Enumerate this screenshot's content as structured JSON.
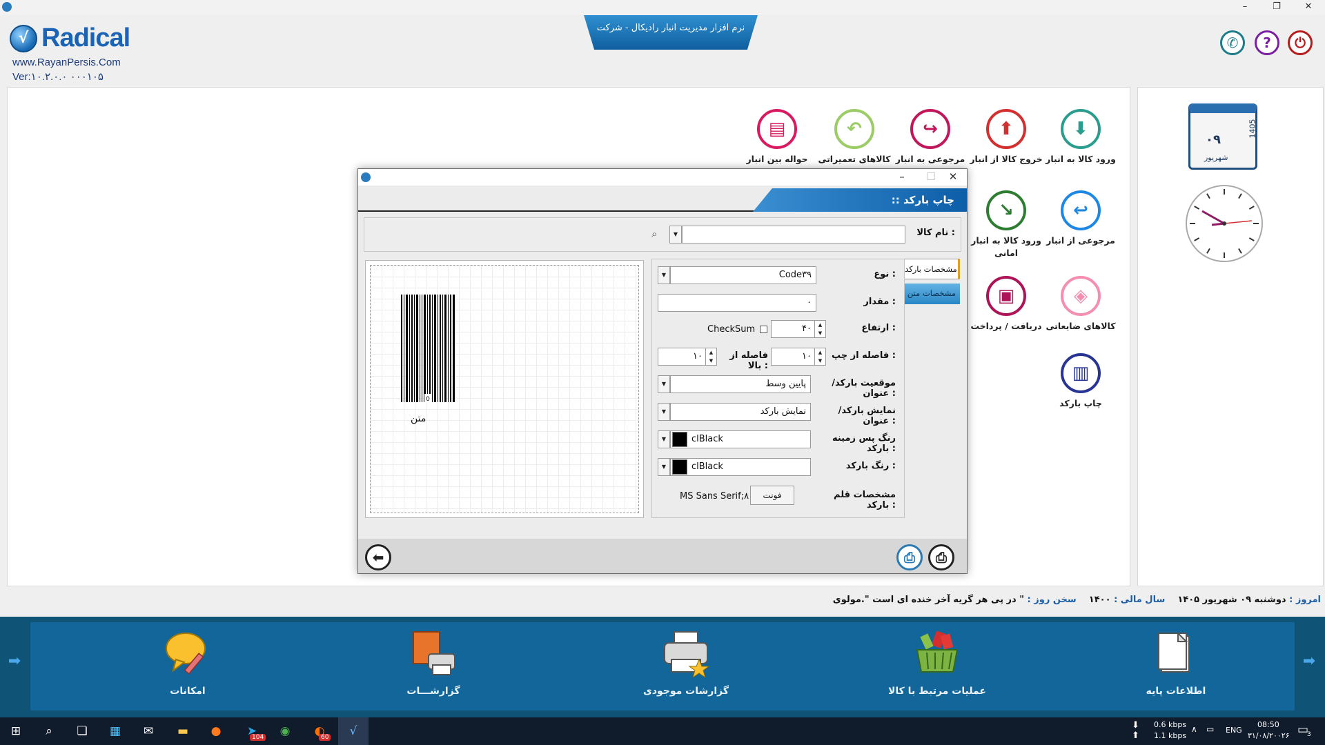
{
  "window": {
    "title": ""
  },
  "header": {
    "logo_text": "Radical",
    "logo_mark": "√",
    "website": "www.RayanPersis.Com",
    "version": "Ver:۱۰.۲.۰.۰   ۰۰۰۱۰۵",
    "app_title": "نرم افزار مدیریت انبار رادیکال - شرکت"
  },
  "header_buttons": {
    "phone": "✆",
    "help": "?",
    "exit": "⏻"
  },
  "calendar": {
    "day": "۰۹",
    "month": "شهریور",
    "year": "1405"
  },
  "modules": [
    {
      "id": "goods-in",
      "label": "ورود کالا به انبار",
      "icon": "box-in-icon",
      "glyph": "⬇",
      "color": "#2a9d8f"
    },
    {
      "id": "goods-out",
      "label": "خروج کالا از انبار",
      "icon": "box-out-icon",
      "glyph": "⬆",
      "color": "#d32f2f"
    },
    {
      "id": "return-in",
      "label": "مرجوعی به انبار",
      "icon": "return-arrow-icon",
      "glyph": "↪",
      "color": "#c2185b"
    },
    {
      "id": "repair",
      "label": "کالاهای تعمیراتی",
      "icon": "undo-arrow-icon",
      "glyph": "↶",
      "color": "#9ccc65"
    },
    {
      "id": "transfer",
      "label": "حواله بین انبار",
      "icon": "document-icon",
      "glyph": "▤",
      "color": "#d81b60"
    },
    {
      "id": "return-out",
      "label": "مرجوعی از انبار",
      "icon": "return-left-icon",
      "glyph": "↩",
      "color": "#1e88e5"
    },
    {
      "id": "consign-in",
      "label": "ورود کالا به انبار امانی",
      "icon": "diagonal-arrow-icon",
      "glyph": "↘",
      "color": "#2e7d32"
    },
    {
      "id": "waste",
      "label": "کالاهای ضایعاتی",
      "icon": "waste-icon",
      "glyph": "◈",
      "color": "#f48fb1"
    },
    {
      "id": "payment",
      "label": "دریافت / پرداخت",
      "icon": "wallet-icon",
      "glyph": "▣",
      "color": "#ad1457"
    },
    {
      "id": "barcode",
      "label": "چاپ بارکد",
      "icon": "barcode-icon",
      "glyph": "▥",
      "color": "#283593"
    }
  ],
  "dialog": {
    "title": ":: چاپ بارکد",
    "product_name_label": "نام کالا :",
    "product_name_value": "",
    "tabs": {
      "barcode": "مشخصات بارکد",
      "text": "مشخصات متن"
    },
    "preview_text": "متن",
    "props": {
      "type_label": "نوع :",
      "type_value": "Code۳۹",
      "value_label": "مقدار :",
      "value_value": "۰",
      "height_label": "ارتفاع :",
      "height_value": "۴۰",
      "checksum_label": "CheckSum",
      "left_label": "فاصله از چپ :",
      "left_value": "۱۰",
      "top_label": "فاصله از بالا :",
      "top_value": "۱۰",
      "position_label": "موقعیت بارکد/ عنوان :",
      "position_value": "پایین وسط",
      "display_label": "نمایش بارکد/ عنوان :",
      "display_value": "نمایش بارکد",
      "bgcolor_label": "رنگ پس زمینه بارکد :",
      "bgcolor_value": "clBlack",
      "color_label": "رنگ بارکد :",
      "color_value": "clBlack",
      "font_label": "مشخصات قلم بارکد :",
      "font_value": "MS Sans Serif;۸",
      "font_button": "فونت"
    }
  },
  "status": {
    "today_label": "امروز :",
    "today_value": "دوشنبه ۰۹ شهریور ۱۴۰۵",
    "fiscal_label": "سال مالی :",
    "fiscal_value": "۱۴۰۰",
    "quote_label": "سخن روز :",
    "quote_value": "\" در پی هر گریه آخر خنده ای است \".مولوی"
  },
  "bottom_menu": [
    {
      "label": "اطلاعات پایه",
      "icon": "document-stack-icon"
    },
    {
      "label": "عملیات مرتبط با کالا",
      "icon": "basket-icon"
    },
    {
      "label": "گزارشات موجودی",
      "icon": "printer-star-icon"
    },
    {
      "label": "گزارشـــات",
      "icon": "report-printer-icon"
    },
    {
      "label": "امکانات",
      "icon": "chat-pencil-icon"
    }
  ],
  "taskbar": {
    "net_down": "0.6 kbps",
    "net_up": "1.1 kbps",
    "lang": "ENG",
    "time": "08:50",
    "date": "۳۱/۰۸/۲۰۰۲۶",
    "telegram_badge": "104",
    "app_badge": "60",
    "notif_count": "3"
  }
}
